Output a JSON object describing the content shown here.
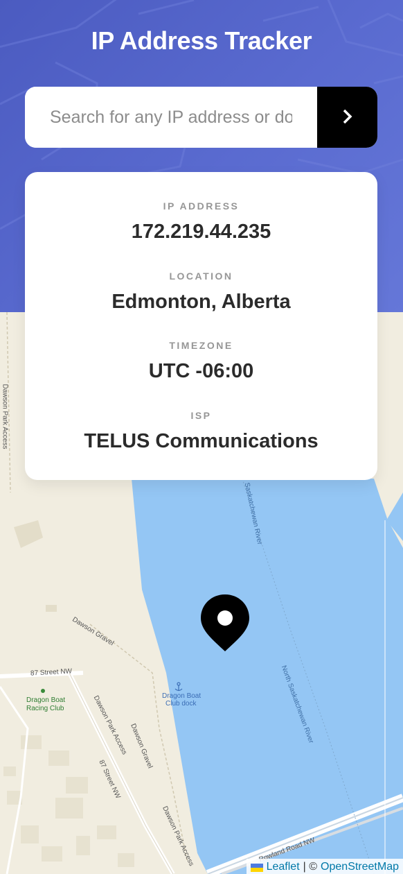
{
  "app": {
    "title": "IP Address Tracker"
  },
  "search": {
    "placeholder": "Search for any IP address or domain",
    "value": "",
    "button_icon": "chevron-right-icon"
  },
  "info": {
    "ip_label": "IP Address",
    "ip_value": "172.219.44.235",
    "location_label": "Location",
    "location_value": "Edmonton, Alberta",
    "timezone_label": "Timezone",
    "timezone_value": "UTC -06:00",
    "isp_label": "ISP",
    "isp_value": "TELUS Communications"
  },
  "map": {
    "labels": {
      "river_upper": "Saskatchewan River",
      "river_lower": "North Saskatchewan River",
      "dawson_gravel_1": "Dawson Gravel",
      "dawson_gravel_2": "Dawson Gravel",
      "street_87_nw_1": "87 Street NW",
      "street_87_nw_2": "87 Street NW",
      "dawson_park_access_1": "Dawson Park Access",
      "dawson_park_access_2": "Dawson Park Access",
      "dawson_park_access_3": "Dawson Park Access",
      "dragon_boat_club_line1": "Dragon Boat",
      "dragon_boat_club_line2": "Racing Club",
      "dragon_boat_dock_line1": "Dragon Boat",
      "dragon_boat_dock_line2": "Club dock",
      "rowland_road": "Rowland Road NW"
    },
    "marker_icon": "location-pin-icon"
  },
  "attribution": {
    "leaflet": "Leaflet",
    "separator": "| ©",
    "osm": "OpenStreetMap"
  },
  "colors": {
    "header_bg": "#5566c8",
    "water": "#94c6f4",
    "land": "#f1ede0",
    "button_bg": "#000000"
  }
}
